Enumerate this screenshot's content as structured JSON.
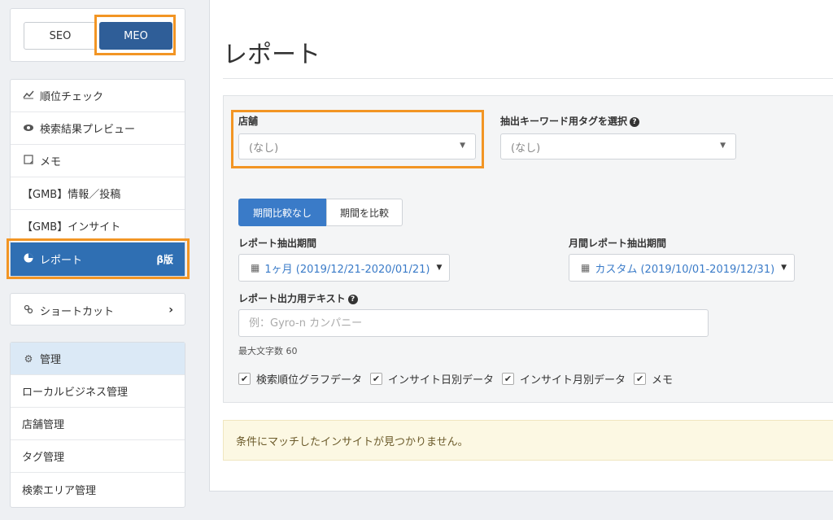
{
  "mode_toggle": {
    "seo_label": "SEO",
    "meo_label": "MEO",
    "selected": "MEO"
  },
  "sidebar": {
    "menu": [
      {
        "icon": "line-chart-icon",
        "label": "順位チェック"
      },
      {
        "icon": "eye-icon",
        "label": "検索結果プレビュー"
      },
      {
        "icon": "memo-icon",
        "label": "メモ"
      },
      {
        "icon": "",
        "label": "【GMB】情報／投稿"
      },
      {
        "icon": "",
        "label": "【GMB】インサイト"
      },
      {
        "icon": "pie-chart-icon",
        "label": "レポート",
        "badge": "β版",
        "active": true
      }
    ],
    "shortcut": {
      "icon": "link-icon",
      "label": "ショートカット",
      "chevron": "chevron-right-icon"
    },
    "admin": {
      "header": {
        "icon": "gear-icon",
        "label": "管理"
      },
      "items": [
        {
          "label": "ローカルビジネス管理"
        },
        {
          "label": "店舗管理"
        },
        {
          "label": "タグ管理"
        },
        {
          "label": "検索エリア管理"
        }
      ]
    }
  },
  "main": {
    "title": "レポート",
    "filters": {
      "store_label": "店舗",
      "store_value": "(なし)",
      "tag_label": "抽出キーワード用タグを選択",
      "tag_value": "(なし)",
      "compare_none": "期間比較なし",
      "compare_period": "期間を比較",
      "report_period_label": "レポート抽出期間",
      "report_period_value": "1ヶ月 (2019/12/21-2020/01/21)",
      "monthly_period_label": "月間レポート抽出期間",
      "monthly_period_value": "カスタム (2019/10/01-2019/12/31)",
      "output_text_label": "レポート出力用テキスト",
      "output_text_placeholder": "例：Gyro-n カンパニー",
      "max_chars_hint": "最大文字数 60",
      "checkboxes": [
        {
          "label": "検索順位グラフデータ",
          "checked": true
        },
        {
          "label": "インサイト日別データ",
          "checked": true
        },
        {
          "label": "インサイト月別データ",
          "checked": true
        },
        {
          "label": "メモ",
          "checked": true
        }
      ]
    },
    "alert": "条件にマッチしたインサイトが見つかりません。"
  },
  "colors": {
    "accent": "#2f6fb3",
    "highlight": "#f29524",
    "alert_bg": "#fcf8e3"
  }
}
